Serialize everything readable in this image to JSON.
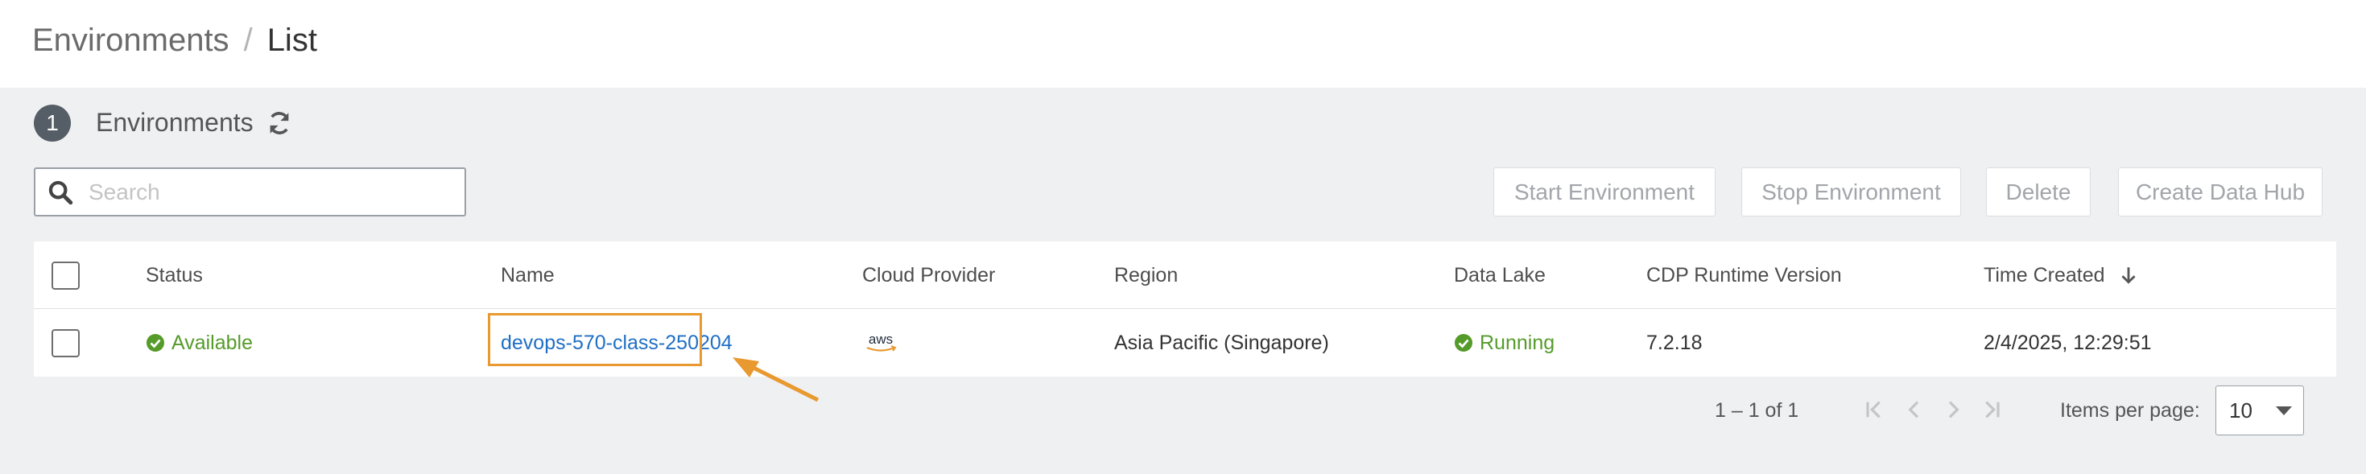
{
  "breadcrumb": {
    "root": "Environments",
    "separator": "/",
    "current": "List"
  },
  "section": {
    "count": "1",
    "title": "Environments"
  },
  "search": {
    "placeholder": "Search"
  },
  "actions": {
    "start": "Start Environment",
    "stop": "Stop Environment",
    "delete": "Delete",
    "create": "Create Data Hub"
  },
  "table": {
    "columns": [
      "Status",
      "Name",
      "Cloud Provider",
      "Region",
      "Data Lake",
      "CDP Runtime Version",
      "Time Created"
    ],
    "rows": [
      {
        "status": "Available",
        "name": "devops-570-class-250204",
        "cloud_provider": "aws",
        "region": "Asia Pacific (Singapore)",
        "data_lake": "Running",
        "runtime_version": "7.2.18",
        "time_created": "2/4/2025, 12:29:51"
      }
    ]
  },
  "pagination": {
    "range": "1 – 1 of 1",
    "items_per_page_label": "Items per page:",
    "items_per_page": "10"
  },
  "colors": {
    "accent": "#1f6fc5",
    "success": "#559b2a",
    "highlight": "#e8992f"
  },
  "icons": [
    "refresh-icon",
    "search-icon",
    "check-circle-icon",
    "aws-logo",
    "sort-arrow-down-icon",
    "first-page-icon",
    "previous-page-icon",
    "next-page-icon",
    "last-page-icon",
    "chevron-down-icon"
  ]
}
